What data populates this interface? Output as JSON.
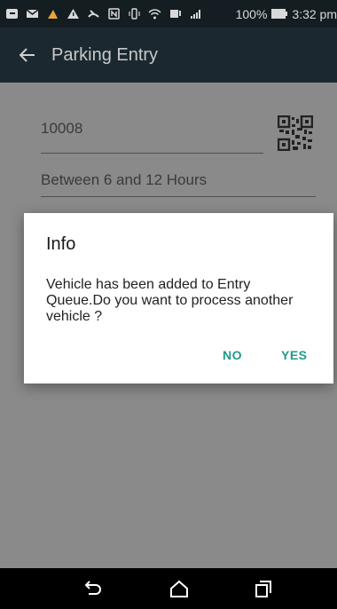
{
  "status_bar": {
    "battery_text": "100%",
    "time": "3:32 pm"
  },
  "app_bar": {
    "title": "Parking Entry"
  },
  "form": {
    "vehicle_number": "10008",
    "duration": "Between 6 and 12 Hours"
  },
  "dialog": {
    "title": "Info",
    "message": "Vehicle has been added to Entry Queue.Do you want to process another vehicle ?",
    "no_label": "NO",
    "yes_label": "YES"
  },
  "nav": {
    "back": "back-icon",
    "home": "home-icon",
    "recents": "recents-icon"
  },
  "colors": {
    "status_bar": "#141d22",
    "app_bar": "#1b2830",
    "accent": "#1f9a8a",
    "dim_background": "#8a8a8a"
  }
}
